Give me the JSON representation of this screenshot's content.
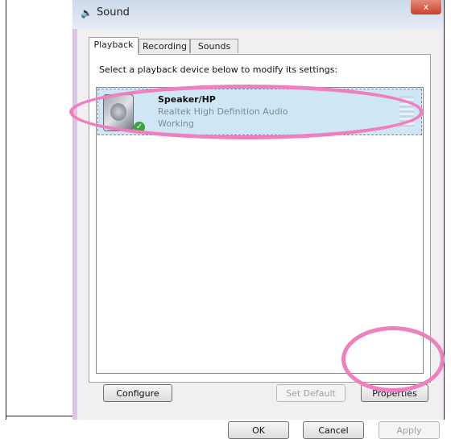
{
  "window": {
    "title": "Sound",
    "close_label": "x"
  },
  "tabs": [
    {
      "label": "Playback",
      "active": true
    },
    {
      "label": "Recording",
      "active": false
    },
    {
      "label": "Sounds",
      "active": false
    }
  ],
  "instruction": "Select a playback device below to modify its settings:",
  "device": {
    "name": "Speaker/HP",
    "description": "Realtek High Definition Audio",
    "status": "Working",
    "icon": "speaker-icon",
    "status_icon": "check-icon"
  },
  "buttons": {
    "configure": "Configure",
    "set_default": "Set Default",
    "properties": "Properties",
    "ok": "OK",
    "cancel": "Cancel",
    "apply": "Apply"
  },
  "colors": {
    "highlight_ring": "#f07fc0",
    "selection": "#cfe7f5"
  }
}
